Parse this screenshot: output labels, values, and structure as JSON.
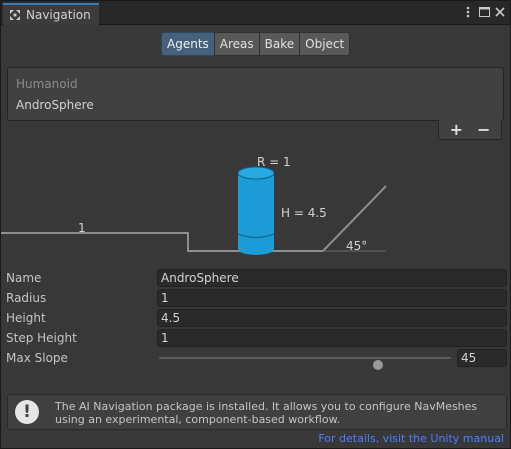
{
  "window": {
    "tab_title": "Navigation",
    "tab_icon": "navigation-icon",
    "controls": [
      "more-options-icon",
      "maximize-icon",
      "close-icon"
    ]
  },
  "toolbar": {
    "tabs": [
      "Agents",
      "Areas",
      "Bake",
      "Object"
    ],
    "active_tab": "Agents"
  },
  "agent_list": {
    "items": [
      "Humanoid",
      "AndroSphere"
    ],
    "selected": "AndroSphere",
    "add_label": "+",
    "remove_label": "−"
  },
  "diagram": {
    "radius_label": "R = 1",
    "height_label": "H = 4.5",
    "step_label": "1",
    "slope_label": "45°",
    "cylinder_color": "#1c9bd7"
  },
  "properties": {
    "name": {
      "label": "Name",
      "value": "AndroSphere"
    },
    "radius": {
      "label": "Radius",
      "value": "1"
    },
    "height": {
      "label": "Height",
      "value": "4.5"
    },
    "step_height": {
      "label": "Step Height",
      "value": "1"
    },
    "max_slope": {
      "label": "Max Slope",
      "value": "45",
      "min": 0,
      "max": 60
    }
  },
  "help": {
    "icon": "warning-icon",
    "text": "The AI Navigation package is installed. It allows you to configure NavMeshes using an experimental, component-based workflow.",
    "link": "For details, visit the Unity manual"
  },
  "colors": {
    "accent": "#3a79bb",
    "active_tab": "#46607c",
    "link": "#4c7fff"
  }
}
